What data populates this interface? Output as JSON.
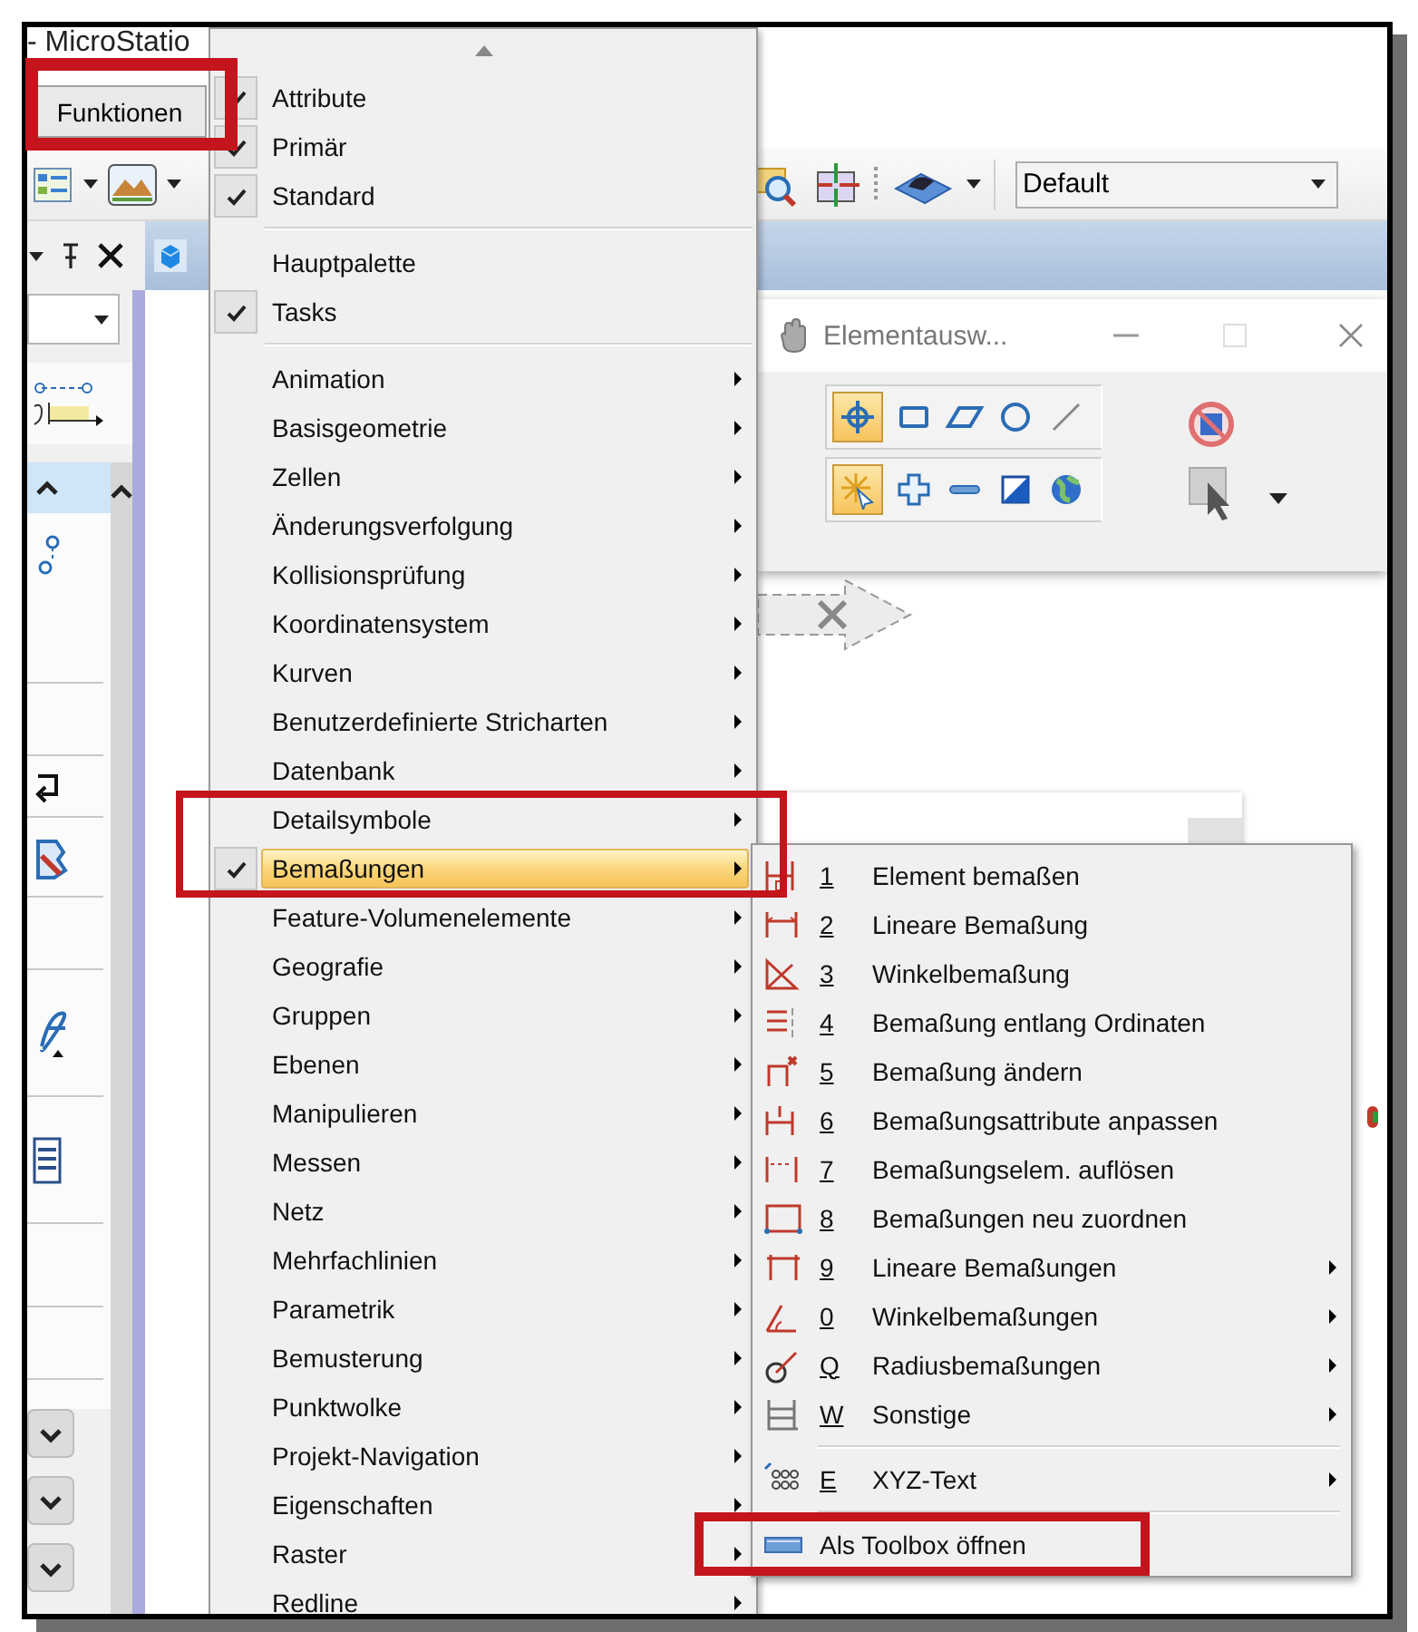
{
  "window": {
    "title": "- MicroStatio"
  },
  "menu_button": {
    "label": "Funktionen"
  },
  "toolbar": {
    "view_dropdown": {
      "value": "Default"
    }
  },
  "tool_window": {
    "title": "Elementausw..."
  },
  "menu": {
    "groups": [
      {
        "items": [
          {
            "label": "Attribute",
            "checked": true,
            "has_submenu": false,
            "selected": false
          },
          {
            "label": "Primär",
            "checked": true,
            "has_submenu": false,
            "selected": false
          },
          {
            "label": "Standard",
            "checked": true,
            "has_submenu": false,
            "selected": false
          }
        ]
      },
      {
        "items": [
          {
            "label": "Hauptpalette",
            "checked": false,
            "has_submenu": false,
            "selected": false
          },
          {
            "label": "Tasks",
            "checked": true,
            "has_submenu": false,
            "selected": false
          }
        ]
      },
      {
        "items": [
          {
            "label": "Animation",
            "checked": false,
            "has_submenu": true,
            "selected": false
          },
          {
            "label": "Basisgeometrie",
            "checked": false,
            "has_submenu": true,
            "selected": false
          },
          {
            "label": "Zellen",
            "checked": false,
            "has_submenu": true,
            "selected": false
          },
          {
            "label": "Änderungsverfolgung",
            "checked": false,
            "has_submenu": true,
            "selected": false
          },
          {
            "label": "Kollisionsprüfung",
            "checked": false,
            "has_submenu": true,
            "selected": false
          },
          {
            "label": "Koordinatensystem",
            "checked": false,
            "has_submenu": true,
            "selected": false
          },
          {
            "label": "Kurven",
            "checked": false,
            "has_submenu": true,
            "selected": false
          },
          {
            "label": "Benutzerdefinierte Stricharten",
            "checked": false,
            "has_submenu": true,
            "selected": false
          },
          {
            "label": "Datenbank",
            "checked": false,
            "has_submenu": true,
            "selected": false
          },
          {
            "label": "Detailsymbole",
            "checked": false,
            "has_submenu": true,
            "selected": false
          },
          {
            "label": "Bemaßungen",
            "checked": true,
            "has_submenu": true,
            "selected": true
          },
          {
            "label": "Feature-Volumenelemente",
            "checked": false,
            "has_submenu": true,
            "selected": false
          },
          {
            "label": "Geografie",
            "checked": false,
            "has_submenu": true,
            "selected": false
          },
          {
            "label": "Gruppen",
            "checked": false,
            "has_submenu": true,
            "selected": false
          },
          {
            "label": "Ebenen",
            "checked": false,
            "has_submenu": true,
            "selected": false
          },
          {
            "label": "Manipulieren",
            "checked": false,
            "has_submenu": true,
            "selected": false
          },
          {
            "label": "Messen",
            "checked": false,
            "has_submenu": true,
            "selected": false
          },
          {
            "label": "Netz",
            "checked": false,
            "has_submenu": true,
            "selected": false
          },
          {
            "label": "Mehrfachlinien",
            "checked": false,
            "has_submenu": true,
            "selected": false
          },
          {
            "label": "Parametrik",
            "checked": false,
            "has_submenu": true,
            "selected": false
          },
          {
            "label": "Bemusterung",
            "checked": false,
            "has_submenu": true,
            "selected": false
          },
          {
            "label": "Punktwolke",
            "checked": false,
            "has_submenu": true,
            "selected": false
          },
          {
            "label": "Projekt-Navigation",
            "checked": false,
            "has_submenu": true,
            "selected": false
          },
          {
            "label": "Eigenschaften",
            "checked": false,
            "has_submenu": true,
            "selected": false
          },
          {
            "label": "Raster",
            "checked": false,
            "has_submenu": true,
            "selected": false
          },
          {
            "label": "Redline",
            "checked": false,
            "has_submenu": true,
            "selected": false
          }
        ]
      }
    ]
  },
  "submenu": {
    "groups": [
      {
        "items": [
          {
            "shortcut": "1",
            "label": "Element bemaßen",
            "has_submenu": false
          },
          {
            "shortcut": "2",
            "label": "Lineare Bemaßung",
            "has_submenu": false
          },
          {
            "shortcut": "3",
            "label": "Winkelbemaßung",
            "has_submenu": false
          },
          {
            "shortcut": "4",
            "label": "Bemaßung entlang Ordinaten",
            "has_submenu": false
          },
          {
            "shortcut": "5",
            "label": "Bemaßung ändern",
            "has_submenu": false
          },
          {
            "shortcut": "6",
            "label": "Bemaßungsattribute anpassen",
            "has_submenu": false
          },
          {
            "shortcut": "7",
            "label": "Bemaßungselem. auflösen",
            "has_submenu": false
          },
          {
            "shortcut": "8",
            "label": "Bemaßungen neu zuordnen",
            "has_submenu": false
          },
          {
            "shortcut": "9",
            "label": "Lineare Bemaßungen",
            "has_submenu": true
          },
          {
            "shortcut": "0",
            "label": "Winkelbemaßungen",
            "has_submenu": true
          },
          {
            "shortcut": "Q",
            "label": "Radiusbemaßungen",
            "has_submenu": true
          },
          {
            "shortcut": "W",
            "label": "Sonstige",
            "has_submenu": true
          }
        ]
      },
      {
        "items": [
          {
            "shortcut": "E",
            "label": "XYZ-Text",
            "has_submenu": true
          }
        ]
      },
      {
        "items": [
          {
            "label": "Als Toolbox öffnen",
            "has_submenu": false
          }
        ]
      }
    ]
  }
}
